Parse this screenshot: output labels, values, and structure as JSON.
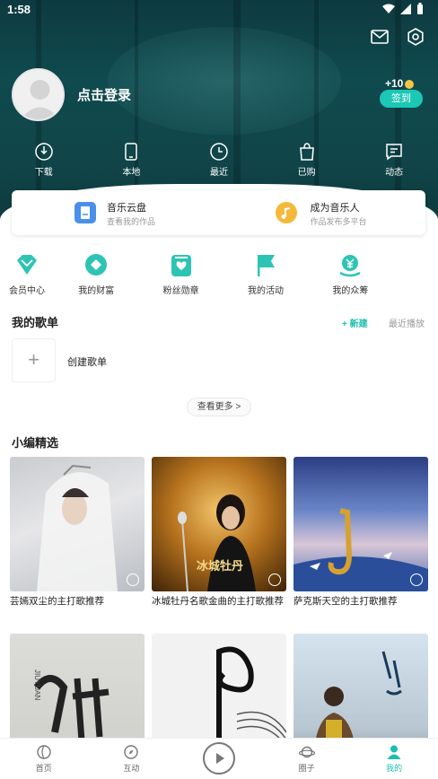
{
  "status_bar": {
    "time": "1:58"
  },
  "header": {
    "login_text": "点击登录",
    "signin_bonus": "+10",
    "signin_label": "签到"
  },
  "quick_links": [
    {
      "label": "下载",
      "icon": "download-icon"
    },
    {
      "label": "本地",
      "icon": "phone-icon"
    },
    {
      "label": "最近",
      "icon": "clock-icon"
    },
    {
      "label": "已购",
      "icon": "bag-icon"
    },
    {
      "label": "动态",
      "icon": "message-icon"
    }
  ],
  "cloud_card": {
    "left": {
      "title": "音乐云盘",
      "subtitle": "查看我的作品",
      "icon": "cloud-disk-icon",
      "color": "#4a90e8"
    },
    "right": {
      "title": "成为音乐人",
      "subtitle": "作品发布多平台",
      "icon": "music-note-icon",
      "color": "#f5b93a"
    }
  },
  "features": [
    {
      "label": "会员中心",
      "icon": "diamond-icon"
    },
    {
      "label": "我的财富",
      "icon": "wealth-icon"
    },
    {
      "label": "粉丝勋章",
      "icon": "medal-icon"
    },
    {
      "label": "我的活动",
      "icon": "flag-icon"
    },
    {
      "label": "我的众筹",
      "icon": "crowdfund-icon"
    }
  ],
  "playlists": {
    "title": "我的歌单",
    "new_label": "+ 新建",
    "recent_label": "最近播放",
    "create_label": "创建歌单",
    "more_label": "查看更多 >"
  },
  "editor_picks": {
    "title": "小编精选",
    "items": [
      {
        "caption": "芸嫣双尘的主打歌推荐"
      },
      {
        "caption": "冰城牡丹名歌金曲的主打歌推荐",
        "cover_text": "冰城牡丹"
      },
      {
        "caption": "萨克斯天空的主打歌推荐"
      },
      {
        "caption": "",
        "cover_text": "JIUYUAN"
      },
      {
        "caption": ""
      },
      {
        "caption": ""
      }
    ]
  },
  "tabbar": [
    {
      "label": "首页",
      "icon": "home-icon"
    },
    {
      "label": "互动",
      "icon": "compass-icon"
    },
    {
      "label": "",
      "icon": "play-icon"
    },
    {
      "label": "圈子",
      "icon": "planet-icon"
    },
    {
      "label": "我的",
      "icon": "person-icon"
    }
  ],
  "colors": {
    "accent": "#1cbfae",
    "hero": "#0f4a4e"
  }
}
